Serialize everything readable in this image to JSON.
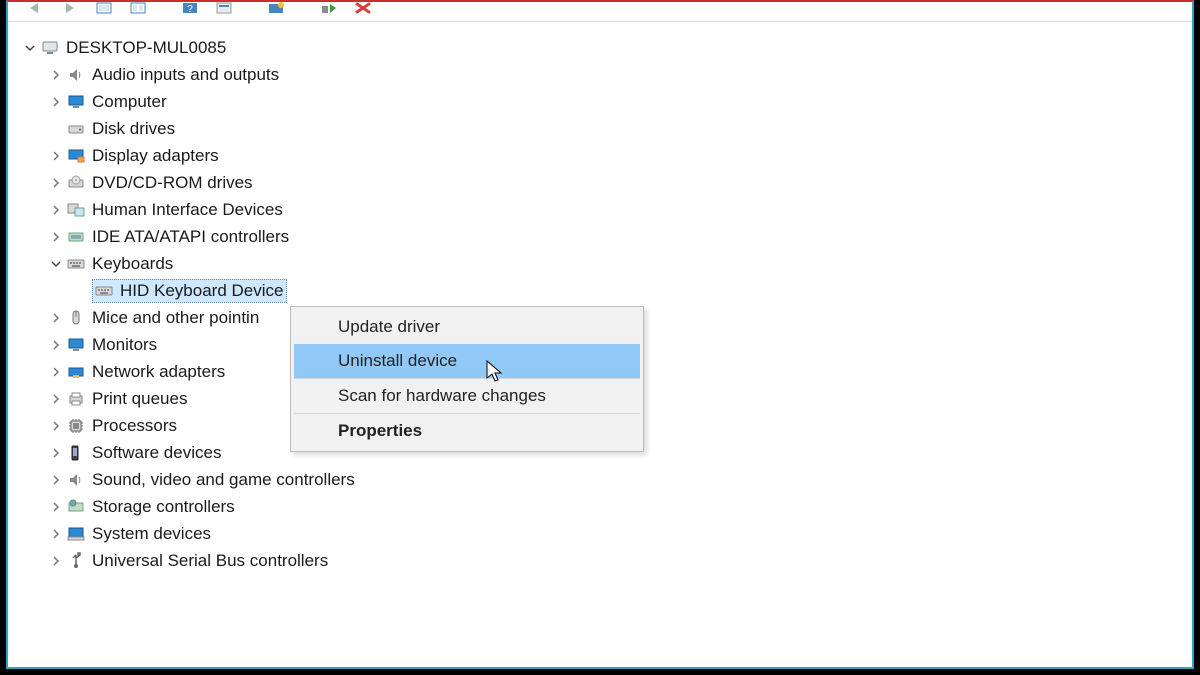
{
  "root": {
    "label": "DESKTOP-MUL0085"
  },
  "tree": {
    "audio": {
      "label": "Audio inputs and outputs"
    },
    "computer": {
      "label": "Computer"
    },
    "disk": {
      "label": "Disk drives"
    },
    "display": {
      "label": "Display adapters"
    },
    "dvd": {
      "label": "DVD/CD-ROM drives"
    },
    "hid": {
      "label": "Human Interface Devices"
    },
    "ide": {
      "label": "IDE ATA/ATAPI controllers"
    },
    "keyboards": {
      "label": "Keyboards"
    },
    "kb_child": {
      "label": "HID Keyboard Device"
    },
    "mice": {
      "label": "Mice and other pointin"
    },
    "monitors": {
      "label": "Monitors"
    },
    "network": {
      "label": "Network adapters"
    },
    "print": {
      "label": "Print queues"
    },
    "cpu": {
      "label": "Processors"
    },
    "softdev": {
      "label": "Software devices"
    },
    "sound": {
      "label": "Sound, video and game controllers"
    },
    "storage": {
      "label": "Storage controllers"
    },
    "system": {
      "label": "System devices"
    },
    "usb": {
      "label": "Universal Serial Bus controllers"
    }
  },
  "menu": {
    "update": "Update driver",
    "uninstall": "Uninstall device",
    "scan": "Scan for hardware changes",
    "properties": "Properties"
  }
}
